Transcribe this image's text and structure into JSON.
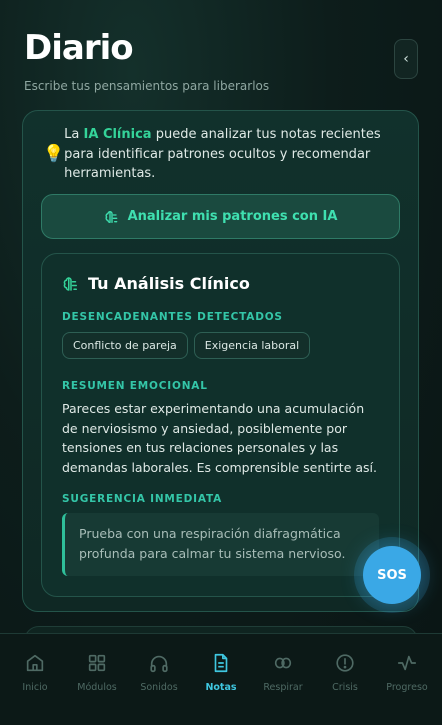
{
  "header": {
    "title": "Diario",
    "subtitle": "Escribe tus pensamientos para liberarlos",
    "back_glyph": "‹"
  },
  "intro": {
    "prefix": "La ",
    "highlight": "IA Clínica",
    "suffix": " puede analizar tus notas recientes para identificar patrones ocultos y recomendar herramientas."
  },
  "analyze_button": {
    "label": "Analizar mis patrones con IA",
    "icon": "brain-icon"
  },
  "analysis": {
    "title": "Tu Análisis Clínico",
    "triggers_label": "DESENCADENANTES DETECTADOS",
    "triggers": [
      "Conflicto de pareja",
      "Exigencia laboral"
    ],
    "summary_label": "RESUMEN EMOCIONAL",
    "summary": "Pareces estar experimentando una acumulación de nerviosismo y ansiedad, posiblemente por tensiones en tus relaciones personales y las demandas laborales. Es comprensible sentirte así.",
    "suggestion_label": "SUGERENCIA INMEDIATA",
    "suggestion": "Prueba con una respiración diafragmática profunda para calmar tu sistema nervioso."
  },
  "sos_label": "SOS",
  "nav": [
    {
      "label": "Inicio",
      "icon": "home-icon",
      "active": false
    },
    {
      "label": "Módulos",
      "icon": "grid-icon",
      "active": false
    },
    {
      "label": "Sonidos",
      "icon": "headphones-icon",
      "active": false
    },
    {
      "label": "Notas",
      "icon": "note-icon",
      "active": true
    },
    {
      "label": "Respirar",
      "icon": "lungs-icon",
      "active": false
    },
    {
      "label": "Crisis",
      "icon": "alert-icon",
      "active": false
    },
    {
      "label": "Progreso",
      "icon": "activity-icon",
      "active": false
    }
  ],
  "colors": {
    "accent_green": "#34d399",
    "accent_cyan": "#3fc7e0",
    "sos_blue": "#3aa8e6",
    "background": "#0d1d1b"
  }
}
